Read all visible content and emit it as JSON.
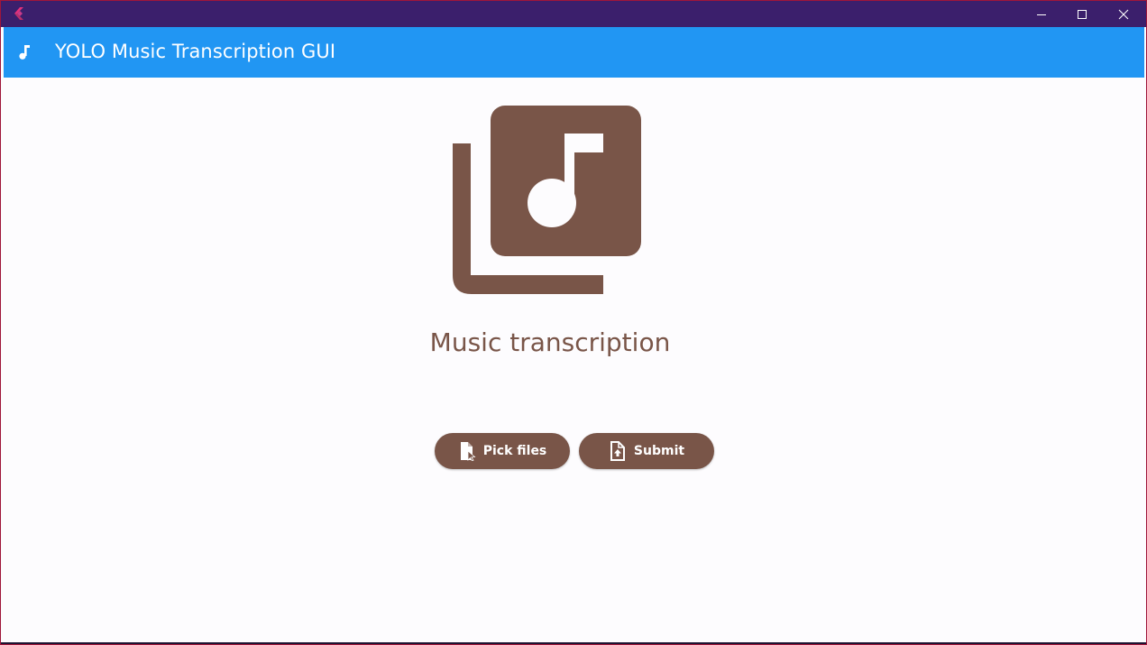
{
  "window": {
    "logo_icon": "flutter-logo-icon",
    "controls": {
      "minimize_icon": "minimize-icon",
      "maximize_icon": "maximize-icon",
      "close_icon": "close-icon"
    }
  },
  "appbar": {
    "icon": "music-note-icon",
    "title": "YOLO Music Transcription GUI",
    "color": "#2196f3"
  },
  "main": {
    "hero_icon": "library-music-icon",
    "heading": "Music transcription",
    "accent_color": "#795548",
    "buttons": {
      "pick_files_label": "Pick files",
      "pick_files_icon": "file-pick-icon",
      "submit_label": "Submit",
      "submit_icon": "file-upload-icon"
    }
  }
}
